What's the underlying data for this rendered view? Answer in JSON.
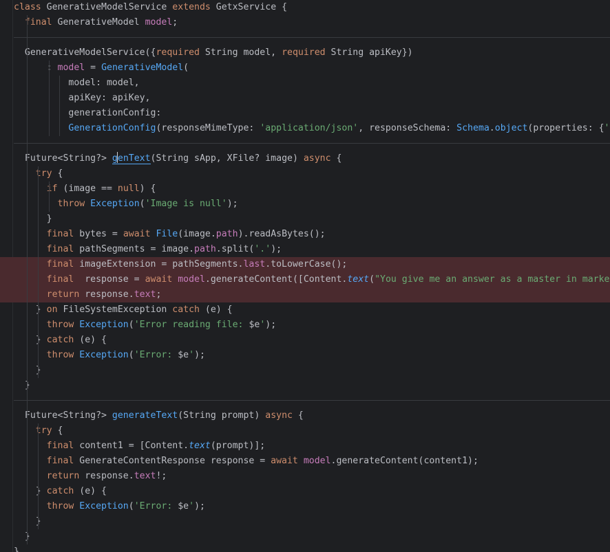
{
  "editor": {
    "lines": [
      [
        [
          "kw",
          "class "
        ],
        [
          "t",
          "GenerativeModelService "
        ],
        [
          "kw",
          "extends "
        ],
        [
          "t",
          "GetxService {"
        ]
      ],
      [
        [
          "t",
          "  "
        ],
        [
          "kw",
          "final "
        ],
        [
          "t",
          "GenerativeModel "
        ],
        [
          "fld",
          "model"
        ],
        [
          "t",
          ";"
        ]
      ],
      [
        [
          "t",
          ""
        ]
      ],
      [
        [
          "t",
          "  GenerativeModelService({"
        ],
        [
          "kw",
          "required "
        ],
        [
          "t",
          "String model, "
        ],
        [
          "kw",
          "required "
        ],
        [
          "t",
          "String apiKey})"
        ]
      ],
      [
        [
          "t",
          "      : "
        ],
        [
          "fld",
          "model"
        ],
        [
          "t",
          " = "
        ],
        [
          "cls",
          "GenerativeModel"
        ],
        [
          "t",
          "("
        ]
      ],
      [
        [
          "t",
          "          model: model,"
        ]
      ],
      [
        [
          "t",
          "          apiKey: apiKey,"
        ]
      ],
      [
        [
          "t",
          "          generationConfig:"
        ]
      ],
      [
        [
          "t",
          "          "
        ],
        [
          "cls",
          "GenerationConfig"
        ],
        [
          "t",
          "(responseMimeType: "
        ],
        [
          "str",
          "'application/json'"
        ],
        [
          "t",
          ", responseSchema: "
        ],
        [
          "cls",
          "Schema"
        ],
        [
          "t",
          "."
        ],
        [
          "fn",
          "object"
        ],
        [
          "t",
          "(properties: {"
        ],
        [
          "str",
          "'"
        ]
      ],
      [
        [
          "t",
          ""
        ]
      ],
      [
        [
          "t",
          "  Future<String?> "
        ],
        [
          "caretfn",
          "genText"
        ],
        [
          "t",
          "(String sApp, XFile? image) "
        ],
        [
          "kw",
          "async"
        ],
        [
          "t",
          " {"
        ]
      ],
      [
        [
          "t",
          "    "
        ],
        [
          "kw",
          "try"
        ],
        [
          "t",
          " {"
        ]
      ],
      [
        [
          "t",
          "      "
        ],
        [
          "kw",
          "if"
        ],
        [
          "t",
          " (image == "
        ],
        [
          "kw",
          "null"
        ],
        [
          "t",
          ") {"
        ]
      ],
      [
        [
          "t",
          "        "
        ],
        [
          "kw",
          "throw "
        ],
        [
          "cls",
          "Exception"
        ],
        [
          "t",
          "("
        ],
        [
          "str",
          "'Image is null'"
        ],
        [
          "t",
          ");"
        ]
      ],
      [
        [
          "t",
          "      }"
        ]
      ],
      [
        [
          "t",
          "      "
        ],
        [
          "kw",
          "final "
        ],
        [
          "t",
          "bytes = "
        ],
        [
          "kw",
          "await "
        ],
        [
          "cls",
          "File"
        ],
        [
          "t",
          "(image."
        ],
        [
          "fld",
          "path"
        ],
        [
          "t",
          ").readAsBytes();"
        ]
      ],
      [
        [
          "t",
          "      "
        ],
        [
          "kw",
          "final "
        ],
        [
          "t",
          "pathSegments = image."
        ],
        [
          "fld",
          "path"
        ],
        [
          "t",
          ".split("
        ],
        [
          "str",
          "'.'"
        ],
        [
          "t",
          ");"
        ]
      ],
      [
        [
          "t",
          "      "
        ],
        [
          "kw",
          "final "
        ],
        [
          "t",
          "imageExtension = pathSegments."
        ],
        [
          "fld",
          "last"
        ],
        [
          "t",
          ".toLowerCase();"
        ]
      ],
      [
        [
          "t",
          "      "
        ],
        [
          "kw",
          "final "
        ],
        [
          "t",
          " response = "
        ],
        [
          "kw",
          "await "
        ],
        [
          "fld",
          "model"
        ],
        [
          "t",
          ".generateContent([Content."
        ],
        [
          "ital",
          "text"
        ],
        [
          "t",
          "("
        ],
        [
          "str",
          "\"You give me an answer as a master in marketi"
        ]
      ],
      [
        [
          "t",
          "      "
        ],
        [
          "kw",
          "return "
        ],
        [
          "t",
          "response."
        ],
        [
          "fld",
          "text"
        ],
        [
          "t",
          ";"
        ]
      ],
      [
        [
          "t",
          "    } "
        ],
        [
          "kw",
          "on "
        ],
        [
          "t",
          "FileSystemException "
        ],
        [
          "kw",
          "catch"
        ],
        [
          "t",
          " (e) {"
        ]
      ],
      [
        [
          "t",
          "      "
        ],
        [
          "kw",
          "throw "
        ],
        [
          "cls",
          "Exception"
        ],
        [
          "t",
          "("
        ],
        [
          "str",
          "'Error reading file: "
        ],
        [
          "t",
          "$e"
        ],
        [
          "str",
          "'"
        ],
        [
          "t",
          ");"
        ]
      ],
      [
        [
          "t",
          "    } "
        ],
        [
          "kw",
          "catch"
        ],
        [
          "t",
          " (e) {"
        ]
      ],
      [
        [
          "t",
          "      "
        ],
        [
          "kw",
          "throw "
        ],
        [
          "cls",
          "Exception"
        ],
        [
          "t",
          "("
        ],
        [
          "str",
          "'Error: "
        ],
        [
          "t",
          "$e"
        ],
        [
          "str",
          "'"
        ],
        [
          "t",
          ");"
        ]
      ],
      [
        [
          "t",
          "    }"
        ]
      ],
      [
        [
          "t",
          "  }"
        ]
      ],
      [
        [
          "t",
          ""
        ]
      ],
      [
        [
          "t",
          "  Future<String?> "
        ],
        [
          "fn",
          "generateText"
        ],
        [
          "t",
          "(String prompt) "
        ],
        [
          "kw",
          "async"
        ],
        [
          "t",
          " {"
        ]
      ],
      [
        [
          "t",
          "    "
        ],
        [
          "kw",
          "try"
        ],
        [
          "t",
          " {"
        ]
      ],
      [
        [
          "t",
          "      "
        ],
        [
          "kw",
          "final "
        ],
        [
          "t",
          "content1 = [Content."
        ],
        [
          "ital",
          "text"
        ],
        [
          "t",
          "(prompt)];"
        ]
      ],
      [
        [
          "t",
          "      "
        ],
        [
          "kw",
          "final "
        ],
        [
          "t",
          "GenerateContentResponse response = "
        ],
        [
          "kw",
          "await "
        ],
        [
          "fld",
          "model"
        ],
        [
          "t",
          ".generateContent(content1);"
        ]
      ],
      [
        [
          "t",
          "      "
        ],
        [
          "kw",
          "return "
        ],
        [
          "t",
          "response."
        ],
        [
          "fld",
          "text"
        ],
        [
          "t",
          "!;"
        ]
      ],
      [
        [
          "t",
          "    } "
        ],
        [
          "kw",
          "catch"
        ],
        [
          "t",
          " (e) {"
        ]
      ],
      [
        [
          "t",
          "      "
        ],
        [
          "kw",
          "throw "
        ],
        [
          "cls",
          "Exception"
        ],
        [
          "t",
          "("
        ],
        [
          "str",
          "'Error: "
        ],
        [
          "t",
          "$e"
        ],
        [
          "str",
          "'"
        ],
        [
          "t",
          ");"
        ]
      ],
      [
        [
          "t",
          "    }"
        ]
      ],
      [
        [
          "t",
          "  }"
        ]
      ],
      [
        [
          "t",
          "}"
        ]
      ]
    ],
    "error_lines": [
      17,
      18,
      19
    ],
    "separator_after": [
      2,
      9,
      26
    ]
  },
  "colors": {
    "background": "#1e1f22",
    "keyword": "#cf8e6d",
    "field": "#c77dbb",
    "function": "#56a8f5",
    "string": "#6aab73",
    "text": "#bcbec4",
    "error_line": "#4a2a2e"
  }
}
